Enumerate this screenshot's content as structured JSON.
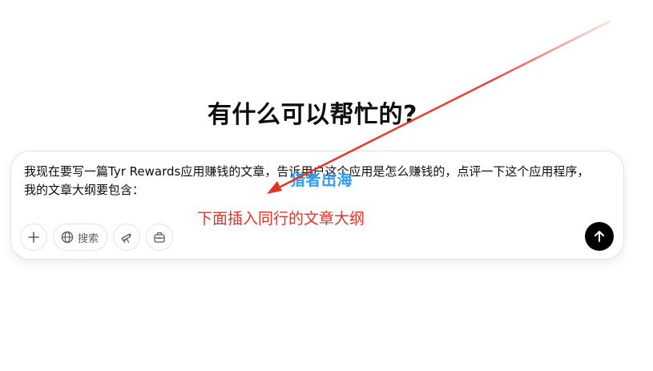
{
  "headline": "有什么可以帮忙的?",
  "composer": {
    "prompt_text": "我现在要写一篇Tyr Rewards应用赚钱的文章，告诉用户这个应用是怎么赚钱的，点评一下这个应用程序，我的文章大纲要包含：",
    "toolbar": {
      "add_icon": "plus-icon",
      "search_icon": "globe-icon",
      "search_label": "搜索",
      "telescope_icon": "telescope-icon",
      "toolbox_icon": "toolbox-icon"
    },
    "send_icon": "arrow-up-icon"
  },
  "watermark": "猎者出海",
  "annotation": {
    "text": "下面插入同行的文章大纲",
    "color": "#e53226"
  },
  "colors": {
    "send_button": "#000000",
    "watermark": "#2a9df4"
  }
}
